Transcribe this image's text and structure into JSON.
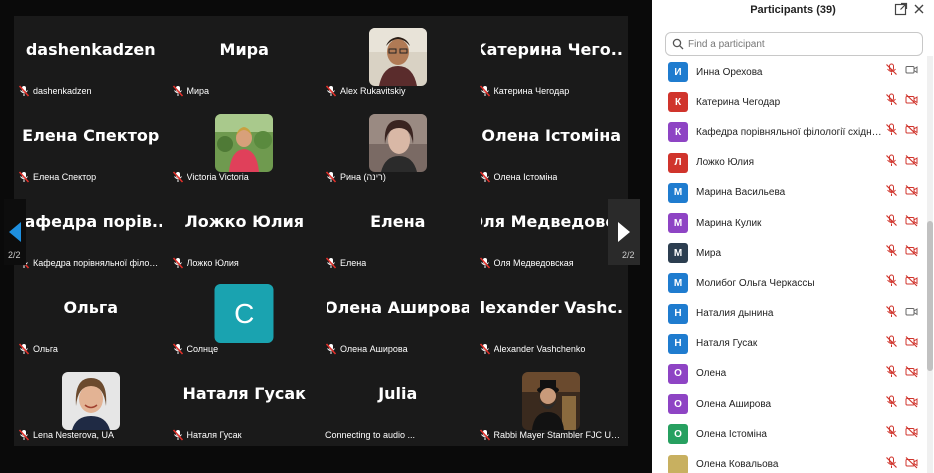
{
  "gallery": {
    "page_indicator": "2/2",
    "tiles": [
      {
        "big": "dashenkadzen",
        "label": "dashenkadzen",
        "type": "name"
      },
      {
        "big": "Мира",
        "label": "Мира",
        "type": "name"
      },
      {
        "big": "",
        "label": "Alex Rukavitskiy",
        "type": "photo",
        "photo": "man-glasses"
      },
      {
        "big": "Катерина  Чего...",
        "label": "Катерина Чегодар",
        "type": "name"
      },
      {
        "big": "Елена Спектор",
        "label": "Елена Спектор",
        "type": "name"
      },
      {
        "big": "",
        "label": "Victoria Victoria",
        "type": "photo",
        "photo": "woman-garden"
      },
      {
        "big": "",
        "label": "Рина (רינה)",
        "type": "photo",
        "photo": "woman-dark"
      },
      {
        "big": "Олена Істоміна",
        "label": "Олена Істоміна",
        "type": "name"
      },
      {
        "big": "Кафедра  порів...",
        "label": "Кафедра порівняльної філологі...",
        "type": "name"
      },
      {
        "big": "Ложко Юлия",
        "label": "Ложко Юлия",
        "type": "name"
      },
      {
        "big": "Елена",
        "label": "Елена",
        "type": "name"
      },
      {
        "big": "Оля  Медведовс...",
        "label": "Оля Медведовская",
        "type": "name"
      },
      {
        "big": "Ольга",
        "label": "Ольга",
        "type": "name"
      },
      {
        "big": "C",
        "label": "Солнце",
        "type": "letter"
      },
      {
        "big": "Олена Аширова",
        "label": "Олена Аширова",
        "type": "name"
      },
      {
        "big": "Alexander  Vashc...",
        "label": "Alexander Vashchenko",
        "type": "name"
      },
      {
        "big": "",
        "label": "Lena Nesterova, UA",
        "type": "photo",
        "photo": "woman-smile"
      },
      {
        "big": "Наталя Гусак",
        "label": "Наталя Гусак",
        "type": "name"
      },
      {
        "big": "Julia",
        "label": "Connecting to audio ...",
        "type": "connecting"
      },
      {
        "big": "",
        "label": "Rabbi Mayer Stambler FJC Ukraine",
        "type": "photo",
        "photo": "rabbi"
      }
    ]
  },
  "panel": {
    "title": "Participants (39)",
    "search_placeholder": "Find a participant",
    "participants": [
      {
        "initial": "И",
        "name": "Инна Орехова",
        "color": "#1f7ccf",
        "video": "on"
      },
      {
        "initial": "К",
        "name": "Катерина Чегодар",
        "color": "#d0342c",
        "video": "off"
      },
      {
        "initial": "К",
        "name": "Кафедра порівняльної філології східних т...",
        "color": "#8e44c4",
        "video": "off"
      },
      {
        "initial": "Л",
        "name": "Ложко Юлия",
        "color": "#d0342c",
        "video": "off"
      },
      {
        "initial": "М",
        "name": "Марина Васильева",
        "color": "#1f7ccf",
        "video": "off"
      },
      {
        "initial": "М",
        "name": "Марина Кулик",
        "color": "#8e44c4",
        "video": "off"
      },
      {
        "initial": "М",
        "name": "Мира",
        "color": "#2c3e50",
        "video": "off"
      },
      {
        "initial": "М",
        "name": "Молибог Ольга Черкассы",
        "color": "#1f7ccf",
        "video": "off"
      },
      {
        "initial": "Н",
        "name": "Наталия  дынина",
        "color": "#1f7ccf",
        "video": "on"
      },
      {
        "initial": "Н",
        "name": "Наталя Гусак",
        "color": "#1f7ccf",
        "video": "off"
      },
      {
        "initial": "О",
        "name": "Олена",
        "color": "#8e44c4",
        "video": "off"
      },
      {
        "initial": "О",
        "name": "Олена Аширова",
        "color": "#8e44c4",
        "video": "off"
      },
      {
        "initial": "О",
        "name": "Олена Істоміна",
        "color": "#27a060",
        "video": "off"
      },
      {
        "initial": "",
        "name": "Олена Ковальова",
        "color": "#c8b060",
        "video": "off"
      }
    ]
  }
}
